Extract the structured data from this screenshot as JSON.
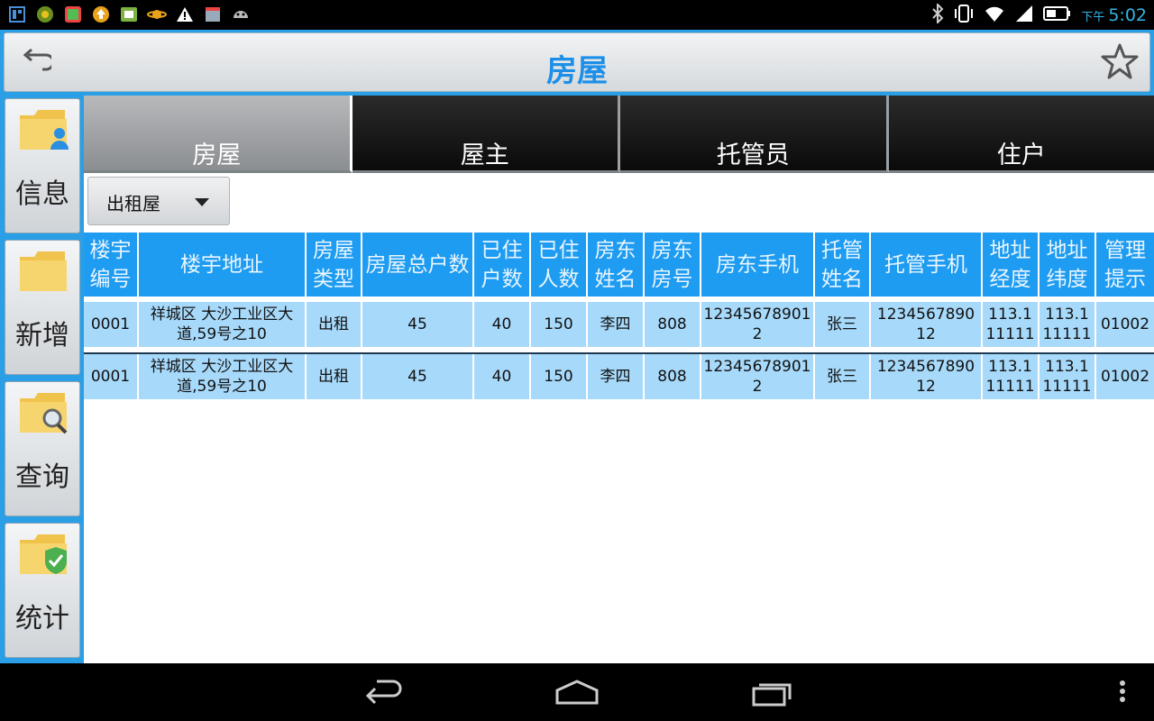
{
  "status_bar": {
    "ampm": "下午",
    "time": "5:02"
  },
  "title_bar": {
    "title": "房屋"
  },
  "sidebar": {
    "items": [
      {
        "label": "信息",
        "icon": "folder-user-icon"
      },
      {
        "label": "新增",
        "icon": "folder-icon"
      },
      {
        "label": "查询",
        "icon": "folder-search-icon"
      },
      {
        "label": "统计",
        "icon": "folder-check-icon"
      }
    ]
  },
  "tabs": [
    {
      "label": "房屋",
      "active": true
    },
    {
      "label": "屋主",
      "active": false
    },
    {
      "label": "托管员",
      "active": false
    },
    {
      "label": "住户",
      "active": false
    }
  ],
  "filter": {
    "selected": "出租屋"
  },
  "table": {
    "headers": [
      "楼宇编号",
      "楼宇地址",
      "房屋类型",
      "房屋总户数",
      "已住户数",
      "已住人数",
      "房东姓名",
      "房东房号",
      "房东手机",
      "托管姓名",
      "托管手机",
      "地址经度",
      "地址纬度",
      "管理提示"
    ],
    "rows": [
      [
        "0001",
        "祥城区 大沙工业区大道,59号之10",
        "出租",
        "45",
        "40",
        "150",
        "李四",
        "808",
        "123456789012",
        "张三",
        "123456789012",
        "113.111111",
        "113.111111",
        "01002"
      ],
      [
        "0001",
        "祥城区 大沙工业区大道,59号之10",
        "出租",
        "45",
        "40",
        "150",
        "李四",
        "808",
        "123456789012",
        "张三",
        "123456789012",
        "113.111111",
        "113.111111",
        "01002"
      ]
    ]
  },
  "colors": {
    "accent": "#1e9cf1",
    "row_bg": "#a7d9fa",
    "title": "#1d8fe8"
  }
}
